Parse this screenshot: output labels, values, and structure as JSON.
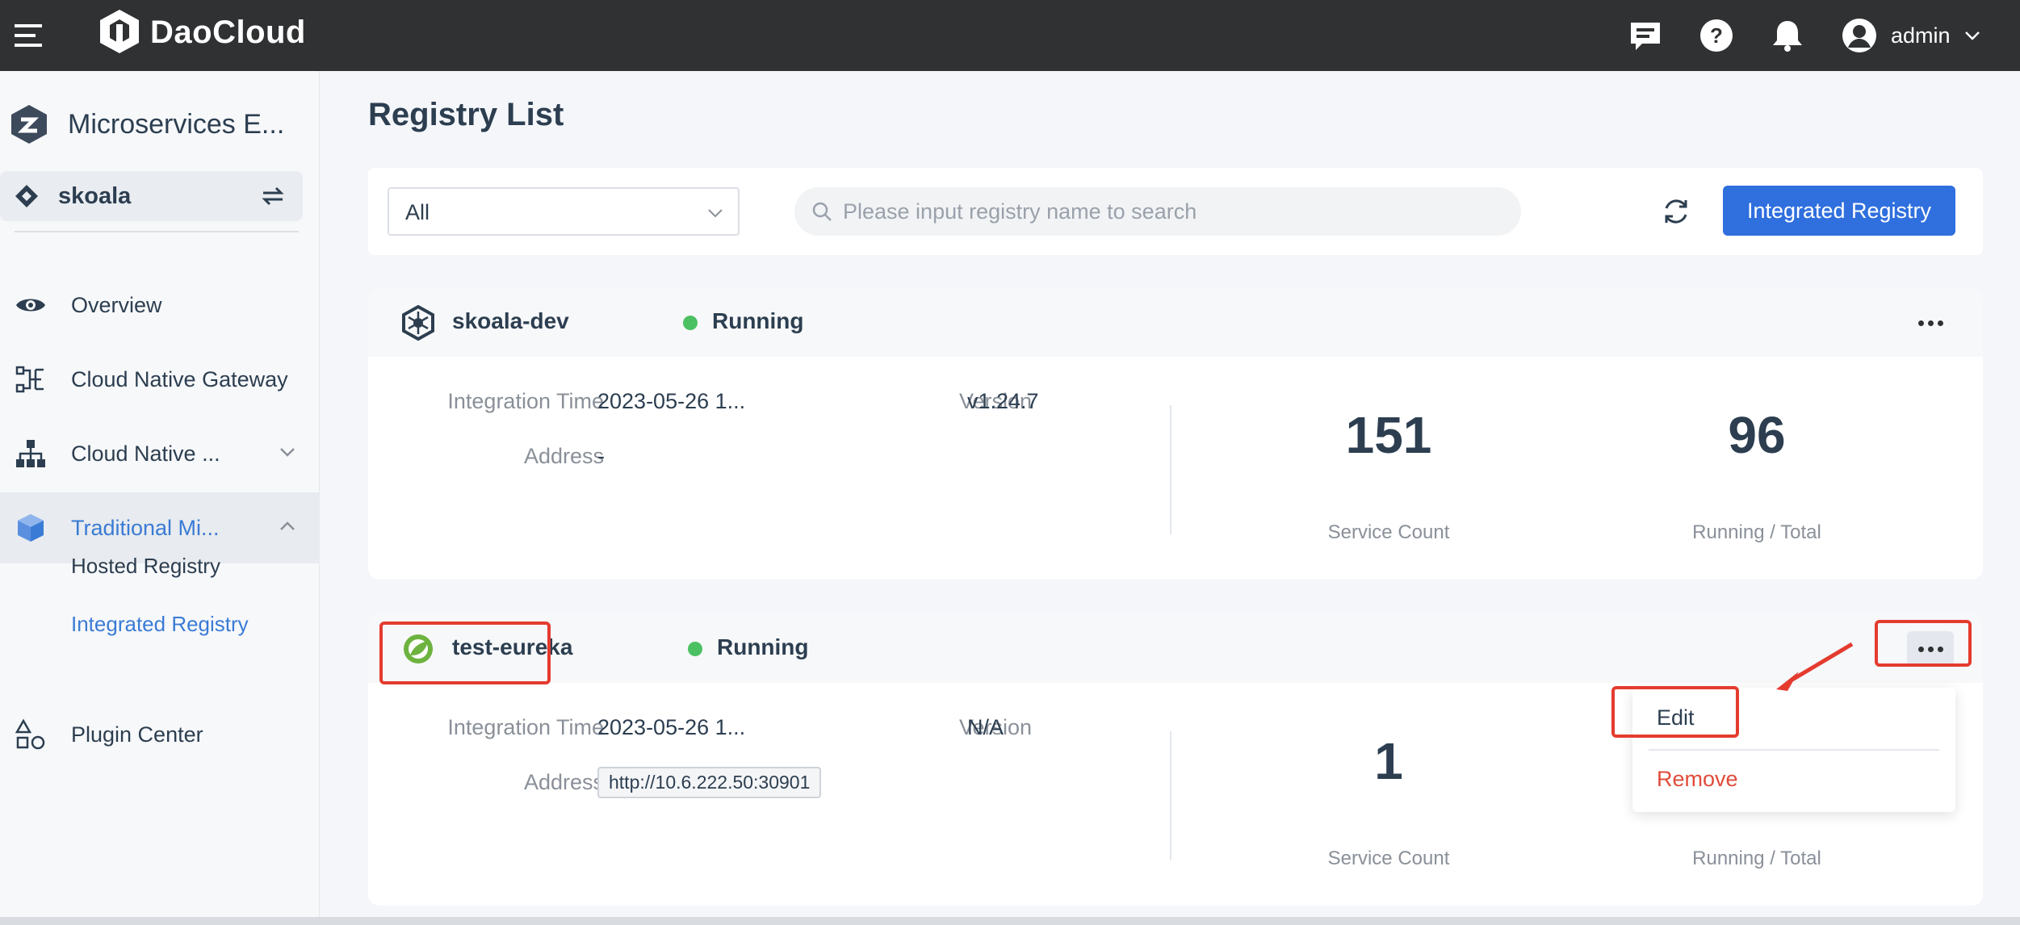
{
  "header": {
    "brand": "DaoCloud",
    "user": "admin",
    "icons": [
      "menu-icon",
      "message-icon",
      "help-icon",
      "bell-icon",
      "user-avatar-icon",
      "chevron-down-icon"
    ]
  },
  "sidebar": {
    "module": "Microservices E...",
    "workspace": "skoala",
    "items": [
      {
        "label": "Overview",
        "icon": "eye-icon"
      },
      {
        "label": "Cloud Native Gateway",
        "icon": "gateway-icon"
      },
      {
        "label": "Cloud Native ...",
        "icon": "hierarchy-icon"
      },
      {
        "label": "Traditional Mi...",
        "icon": "cube-icon"
      },
      {
        "label": "Plugin Center",
        "icon": "shapes-icon"
      }
    ],
    "subitems": [
      {
        "label": "Hosted Registry"
      },
      {
        "label": "Integrated Registry"
      }
    ]
  },
  "main": {
    "title": "Registry List",
    "filter_value": "All",
    "search_placeholder": "Please input registry name to search",
    "primary_button": "Integrated Registry"
  },
  "registries": [
    {
      "name": "skoala-dev",
      "status": "Running",
      "integration_time_label": "Integration Time",
      "integration_time": "2023-05-26 1...",
      "version_label": "Version",
      "version": "v1.24.7",
      "address_label": "Address",
      "address": "-",
      "service_count": "151",
      "service_count_label": "Service Count",
      "running_total": "96",
      "running_total_label": "Running / Total"
    },
    {
      "name": "test-eureka",
      "status": "Running",
      "integration_time_label": "Integration Time",
      "integration_time": "2023-05-26 1...",
      "version_label": "Version",
      "version": "N/A",
      "address_label": "Address",
      "address": "http://10.6.222.50:30901",
      "service_count": "1",
      "service_count_label": "Service Count",
      "running_total_label": "Running / Total"
    }
  ],
  "dropdown": {
    "edit": "Edit",
    "remove": "Remove"
  },
  "colors": {
    "topbar": "#303133",
    "primary": "#2f6fde",
    "active_nav": "#3a7bd5",
    "status_running": "#4cc163",
    "danger": "#e04b3a",
    "annotation": "#e43b2f"
  }
}
